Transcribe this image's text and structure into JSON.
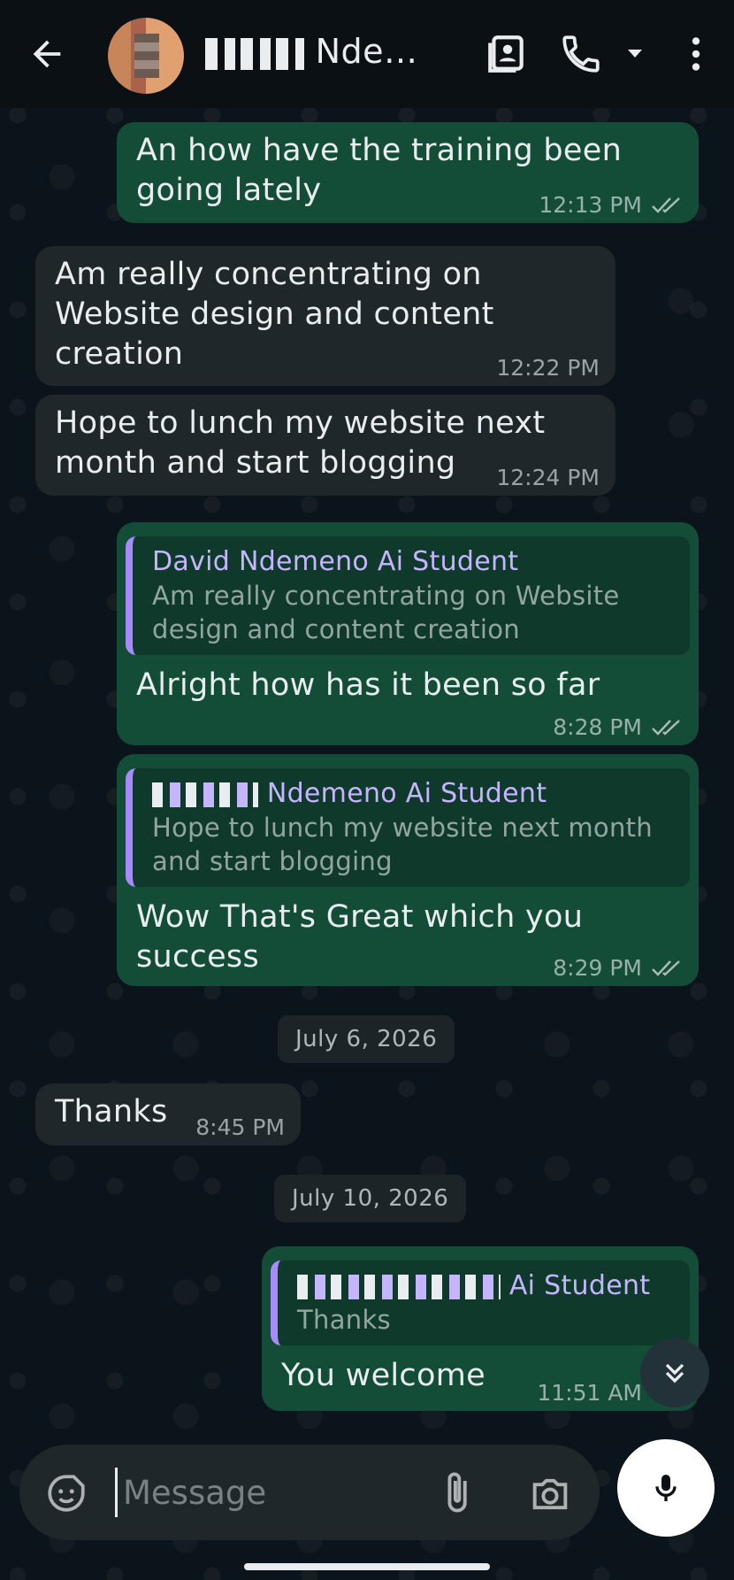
{
  "header": {
    "contact_name": "Ndem...",
    "icons": [
      "back-arrow-icon",
      "contact-card-icon",
      "phone-icon",
      "caret-down-icon",
      "more-vert-icon"
    ]
  },
  "messages": [
    {
      "direction": "out",
      "text": "An how have the training been going lately",
      "time": "12:13 PM",
      "status": "read"
    },
    {
      "direction": "in",
      "text": "Am really concentrating on Website design and content creation",
      "time": "12:22 PM"
    },
    {
      "direction": "in",
      "text": "Hope to lunch my website next month and start blogging",
      "time": "12:24 PM"
    },
    {
      "direction": "out",
      "quote_name": "David Ndemeno Ai Student",
      "quote_text": "Am really concentrating on Website design and content creation",
      "text": "Alright how has it been so far",
      "time": "8:28 PM",
      "status": "read"
    },
    {
      "direction": "out",
      "quote_name": "Ndemeno Ai Student",
      "quote_text": "Hope to lunch my website next month and start blogging",
      "text": "Wow That's Great which you success",
      "time": "8:29 PM",
      "status": "read"
    },
    {
      "direction": "in",
      "text": "Thanks",
      "time": "8:45 PM"
    },
    {
      "direction": "out",
      "quote_name": "Ai Student",
      "quote_text": "Thanks",
      "text": "You welcome",
      "time": "11:51 AM",
      "status": "read"
    }
  ],
  "dates": [
    "July 6, 2026",
    "July 10, 2026"
  ],
  "composer": {
    "placeholder": "Message"
  },
  "colors": {
    "outgoing_bubble": "#144d37",
    "incoming_bubble": "#1f272a",
    "quote_accent": "#a78bfa",
    "background": "#0b141a"
  }
}
